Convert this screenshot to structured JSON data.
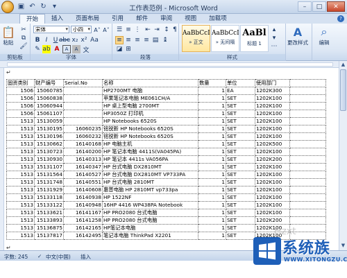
{
  "window": {
    "title": "工作表范例 - Microsoft Word"
  },
  "tabs": [
    "开始",
    "插入",
    "页面布局",
    "引用",
    "邮件",
    "审阅",
    "视图",
    "加载项"
  ],
  "ribbon": {
    "clipboard": {
      "label": "剪贴板",
      "paste": "粘贴"
    },
    "font": {
      "label": "字体",
      "font_name": "宋体",
      "font_size": "小四"
    },
    "paragraph": {
      "label": "段落"
    },
    "styles": {
      "label": "样式",
      "items": [
        {
          "sample": "AaBbCcI",
          "name": "» 正文"
        },
        {
          "sample": "AaBbCcI",
          "name": "» 无间隔"
        },
        {
          "sample": "AaBl",
          "name": "标题 1"
        }
      ],
      "change_styles": "更改样式"
    },
    "editing": {
      "label": "编辑"
    }
  },
  "table": {
    "headers": [
      "固资类别",
      "财产编号",
      "Serial.No",
      "名称",
      "数量",
      "单位",
      "使用部门"
    ],
    "rows": [
      [
        "1506",
        "15060785",
        "",
        "HP2700MT 电脑",
        "1",
        "EA",
        "1202K300"
      ],
      [
        "1506",
        "15060838",
        "",
        "苹果笔记本电脑 ME061CH/A",
        "1",
        "SET",
        "1202K100"
      ],
      [
        "1506",
        "15060944",
        "",
        "HP 桌上型电脑 2700MT",
        "1",
        "SET",
        "1202K100"
      ],
      [
        "1506",
        "15061107",
        "",
        "HP3050Z 打印机",
        "1",
        "SET",
        "1202K100"
      ],
      [
        "1513",
        "15130059",
        "",
        "HP Notebooks 6520S",
        "1",
        "SET",
        "1202K100"
      ],
      [
        "1513",
        "15130195",
        "16060235",
        "铭锐新 HP Notebooks 6520S",
        "1",
        "SET",
        "1202K100"
      ],
      [
        "1513",
        "15130196",
        "16060232",
        "铭锐新 HP Notebooks 6520S",
        "1",
        "SET",
        "1202K100"
      ],
      [
        "1513",
        "15130662",
        "16140168",
        "HP 电脑主机",
        "1",
        "SET",
        "1202K500"
      ],
      [
        "1513",
        "15130723",
        "16140200",
        "HP 笔记本电脑 4411S(VA045PA)",
        "1",
        "SET",
        "1202K100"
      ],
      [
        "1513",
        "15130930",
        "16140313",
        "HP 笔记本 4411s VA056PA",
        "1",
        "SET",
        "1202K200"
      ],
      [
        "1513",
        "15131107",
        "16140347",
        "HP 台式电脑 DX2810MT",
        "1",
        "SET",
        "1202K100"
      ],
      [
        "1513",
        "15131564",
        "16140527",
        "HP 台式电脑 DX2810MT VP733PA",
        "1",
        "SET",
        "1202K100"
      ],
      [
        "1513",
        "15131748",
        "16140551",
        "HP 台式电脑 2810MT",
        "1",
        "SET",
        "1202K100"
      ],
      [
        "1513",
        "15131929",
        "16140608",
        "惠普电脑 HP 2810MT vp733pa",
        "1",
        "SET",
        "1202K100"
      ],
      [
        "1513",
        "15133118",
        "16140938",
        "HP 1522NF",
        "1",
        "SET",
        "1202K100"
      ],
      [
        "1513",
        "15133122",
        "16140948",
        "16HP 4416 WP438PA Notebook",
        "1",
        "SET",
        "1202K100"
      ],
      [
        "1513",
        "15133621",
        "16141167",
        "HP PRO2080 台式电脑",
        "1",
        "SET",
        "1202K100"
      ],
      [
        "1513",
        "15133893",
        "16141258",
        "HP PRO2080 台式电脑",
        "1",
        "SET",
        "1202K200"
      ],
      [
        "1513",
        "15136875",
        "16142165",
        "HP笔记本电脑",
        "1",
        "SET",
        "1202K100"
      ],
      [
        "1513",
        "15137817",
        "16142495",
        "笔记本电脑 ThinkPad X2201",
        "1",
        "SET",
        "1202K100"
      ]
    ]
  },
  "statusbar": {
    "word_count": "字数: 245",
    "language": "中文(中国)",
    "mode": "插入"
  },
  "watermark": {
    "brand": "系统族",
    "url": "WWW.XITONGZU.COM",
    "faint": "Hzxt"
  },
  "colors": {
    "ribbon_bg": "#dbe6f4",
    "accent": "#1e5fb8"
  }
}
